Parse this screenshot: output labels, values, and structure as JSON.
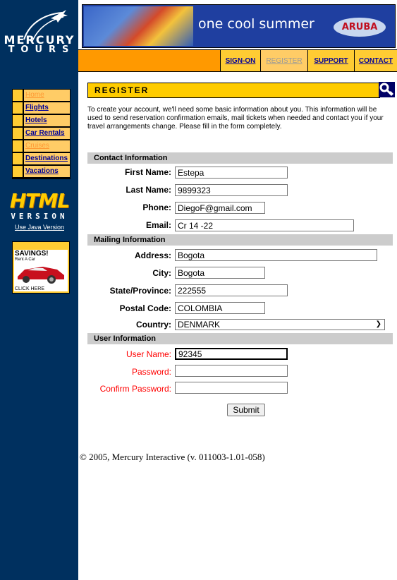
{
  "brand": {
    "line1": "MERCURY",
    "line2": "TOURS"
  },
  "nav": [
    "Home",
    "Flights",
    "Hotels",
    "Car Rentals",
    "Cruises",
    "Destinations",
    "Vacations"
  ],
  "html_version": {
    "big": "HTML",
    "ver": "VERSION",
    "link": "Use Java Version"
  },
  "ad": {
    "title": "SAVINGS!",
    "sub": "Rent A Car",
    "cta": "CLICK HERE"
  },
  "banner": {
    "headline": "one cool summer",
    "brand": "ARUBA"
  },
  "topmenu": {
    "signon": "SIGN-ON",
    "register": "REGISTER",
    "support": "SUPPORT",
    "contact": "CONTACT"
  },
  "page": {
    "title": "REGISTER",
    "intro": "To create your account, we'll need some basic information about you. This information will be used to send reservation confirmation emails, mail tickets when needed and contact you if your travel arrangements change. Please fill in the form completely."
  },
  "form": {
    "contact_header": "Contact Information",
    "first_name_label": "First Name:",
    "first_name": "Estepa",
    "last_name_label": "Last Name:",
    "last_name": "9899323",
    "phone_label": "Phone:",
    "phone": "DiegoF@gmail.com",
    "email_label": "Email:",
    "email": "Cr 14 -22",
    "mailing_header": "Mailing Information",
    "address_label": "Address:",
    "address": "Bogota",
    "city_label": "City:",
    "city": "Bogota",
    "state_label": "State/Province:",
    "state": "222555",
    "postal_label": "Postal Code:",
    "postal": "COLOMBIA",
    "country_label": "Country:",
    "country": "DENMARK",
    "user_header": "User Information",
    "username_label": "User Name:",
    "username": "92345",
    "password_label": "Password:",
    "password": "",
    "confirm_label": "Confirm Password:",
    "confirm": "",
    "submit": "Submit"
  },
  "footer": "© 2005, Mercury Interactive (v. 011003-1.01-058)"
}
